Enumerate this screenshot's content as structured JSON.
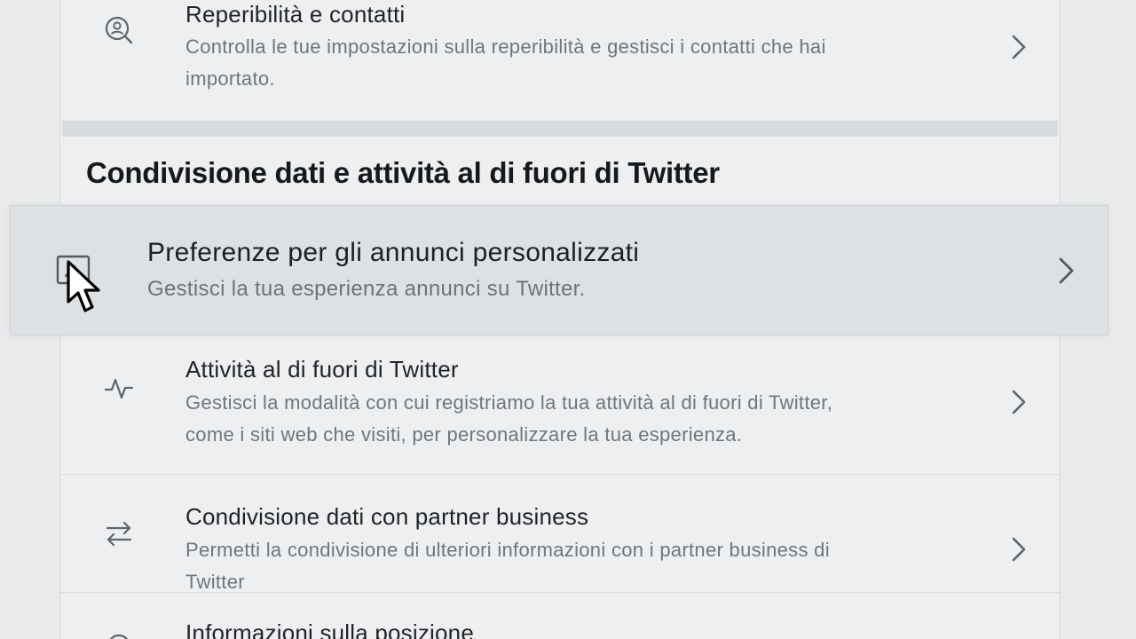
{
  "rows": {
    "discoverability": {
      "title": "Reperibilità e contatti",
      "desc_line1": "Controlla le tue impostazioni sulla reperibilità e gestisci i contatti che hai",
      "desc_line2": "importato.",
      "icon": "person-search-icon"
    },
    "off_twitter_activity": {
      "title": "Attività al di fuori di Twitter",
      "desc_line1": "Gestisci la modalità con cui registriamo la tua attività al di fuori di Twitter,",
      "desc_line2": "come i siti web che visiti, per personalizzare la tua esperienza.",
      "icon": "activity-pulse-icon"
    },
    "business_partners": {
      "title": "Condivisione dati con partner business",
      "desc_line1": "Permetti la condivisione di ulteriori informazioni con i partner business di",
      "desc_line2": "Twitter",
      "icon": "swap-arrows-icon"
    },
    "location": {
      "title": "Informazioni sulla posizione"
    }
  },
  "section": {
    "title": "Condivisione dati e attività al di fuori di Twitter"
  },
  "highlighted": {
    "title": "Preferenze per gli annunci personalizzati",
    "desc": "Gestisci la tua esperienza annunci su Twitter.",
    "icon": "ad-frame-icon"
  },
  "colors": {
    "background": "#e9eaeb",
    "panel": "#eeeff0",
    "highlight": "#dee1e4",
    "title_text": "#1f2327",
    "secondary_text": "#6c7780"
  }
}
